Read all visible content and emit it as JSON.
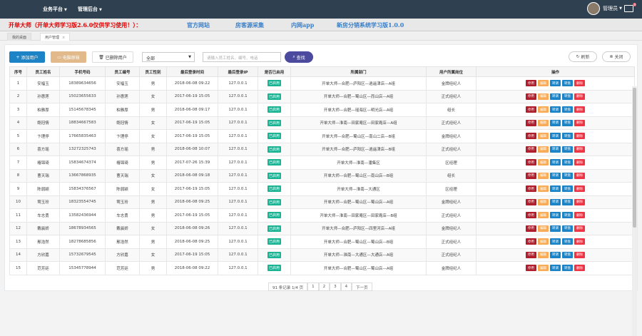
{
  "topnav": {
    "items": [
      "业务平台",
      "管理后台"
    ],
    "user": "管理员",
    "mail_count": "8"
  },
  "banner": {
    "title": "开单大师（开单大师学习版2.6.0仅供学习使用！）：",
    "links": [
      "官方网站",
      "房客源采集",
      "内网app",
      "新房分销系统学习版1.0.0"
    ]
  },
  "tabs": {
    "home": "我的桌面",
    "active": "用户管理",
    "close": "×"
  },
  "toolbar": {
    "add": "添加用户",
    "review": "电脑审核",
    "deleted": "已删除用户",
    "dept_select": "全部",
    "search_placeholder": "请输入员工姓名、编号、电话",
    "search": "查找",
    "refresh": "刷新",
    "close": "关闭"
  },
  "table": {
    "headers": [
      "序号",
      "员工姓名",
      "手机号码",
      "员工编号",
      "员工性别",
      "最后登录时间",
      "最后登录IP",
      "是否已启用",
      "所属部门",
      "用户所属岗位",
      "操作"
    ],
    "enabled_label": "已启用",
    "actions": [
      "停用",
      "编辑",
      "转调",
      "转盘",
      "删除"
    ],
    "rows": [
      [
        "1",
        "安福玉",
        "18389634656",
        "安福玉",
        "男",
        "2018-06-08 09:22",
        "127.0.0.1",
        "开单大师—合肥—庐阳区—逍遥津店—A组",
        "金牌经纪人"
      ],
      [
        "2",
        "孙惠莲",
        "15023655633",
        "孙惠莲",
        "女",
        "2017-06-19 15:05",
        "127.0.0.1",
        "开单大师—合肥—蜀山区—而山店—A组",
        "正式经纪人"
      ],
      [
        "3",
        "柏雅厚",
        "15145678345",
        "柏雅厚",
        "男",
        "2018-06-08 09:17",
        "127.0.0.1",
        "开单大师—合肥—瑶海区—明光店—A组",
        "组长"
      ],
      [
        "4",
        "鲍冠情",
        "18834667583",
        "鲍冠情",
        "女",
        "2017-06-19 15:05",
        "127.0.0.1",
        "开单大师—淮南—田家庵区—田家庵店—A组",
        "正式经纪人"
      ],
      [
        "5",
        "卞理停",
        "17665835463",
        "卞理停",
        "女",
        "2017-06-19 15:05",
        "127.0.0.1",
        "开单大师—合肥—蜀山区—南山二店—B组",
        "金牌经纪人"
      ],
      [
        "6",
        "喜方瑶",
        "13272325743",
        "喜方瑶",
        "男",
        "2018-06-08 10:07",
        "127.0.0.1",
        "开单大师—合肥—庐阳区—逍遥津店—B组",
        "正式经纪人"
      ],
      [
        "7",
        "椿锦琦",
        "15834674374",
        "椿锦琦",
        "男",
        "2017-07-26 15:39",
        "127.0.0.1",
        "开单大师—淮南—潘集区",
        "区经理"
      ],
      [
        "8",
        "曹天瑞",
        "13667868935",
        "曹天瑞",
        "女",
        "2018-06-08 09:18",
        "127.0.0.1",
        "开单大师—合肥—蜀山区—南山店—B组",
        "组长"
      ],
      [
        "9",
        "陈弱颖",
        "15834376567",
        "陈弱颖",
        "女",
        "2017-06-19 15:05",
        "127.0.0.1",
        "开单大师—淮南—大通区",
        "区经理"
      ],
      [
        "10",
        "莺玉玢",
        "18323554745",
        "莺玉玢",
        "男",
        "2018-06-08 09:25",
        "127.0.0.1",
        "开单大师—合肥—蜀山区—蜀山店—A组",
        "金牌经纪人"
      ],
      [
        "11",
        "车志勇",
        "13582436944",
        "车志勇",
        "男",
        "2017-06-19 15:05",
        "127.0.0.1",
        "开单大师—淮南—田家庵区—田家庵店—B组",
        "正式经纪人"
      ],
      [
        "12",
        "戴晨娇",
        "18678934565",
        "戴晨娇",
        "女",
        "2018-06-08 09:26",
        "127.0.0.1",
        "开单大师—合肥—庐阳区—四里河店—A组",
        "金牌经纪人"
      ],
      [
        "13",
        "鄢浩然",
        "18278685856",
        "鄢浩然",
        "男",
        "2018-06-08 09:25",
        "127.0.0.1",
        "开单大师—合肥—蜀山区—蜀山店—B组",
        "正式经纪人"
      ],
      [
        "14",
        "方欣嘉",
        "15732679545",
        "方欣嘉",
        "女",
        "2017-06-19 15:05",
        "127.0.0.1",
        "开单大师—淮南—大通区—大通店—A组",
        "正式经纪人"
      ],
      [
        "15",
        "范芳廷",
        "15345778944",
        "范芳廷",
        "男",
        "2018-06-08 09:22",
        "127.0.0.1",
        "开单大师—合肥—蜀山区—蜀山店—A组",
        "金牌经纪人"
      ]
    ]
  },
  "pager": {
    "summary": "91 条记录 1/4 页",
    "pages": [
      "1",
      "2",
      "3",
      "4"
    ],
    "next": "下一页"
  }
}
